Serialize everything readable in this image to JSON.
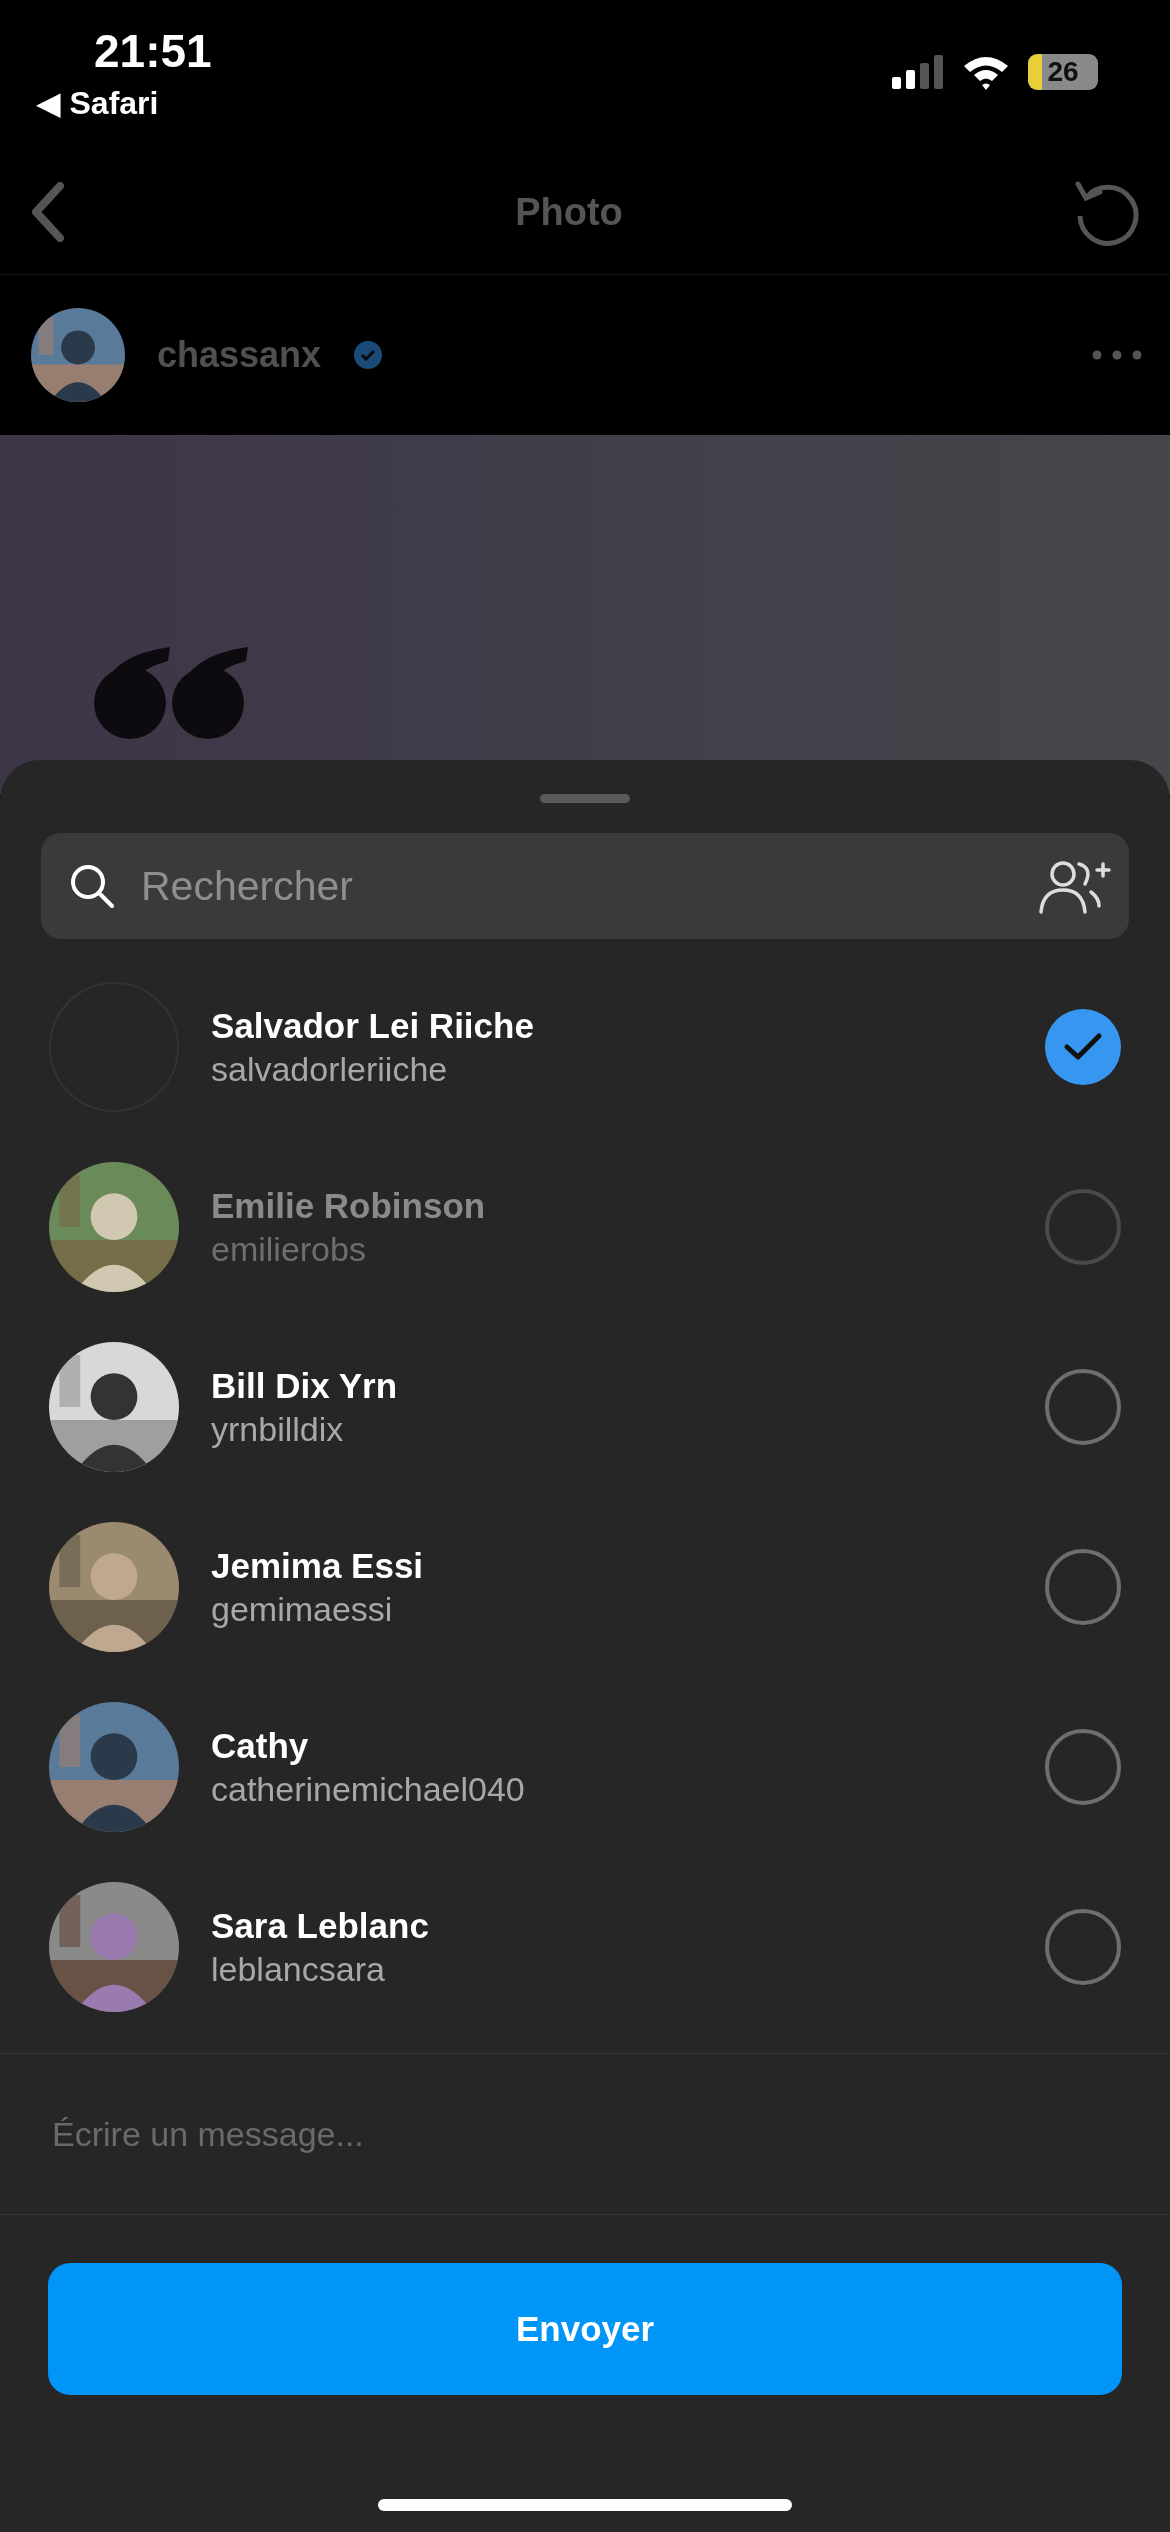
{
  "status_bar": {
    "time": "21:51",
    "back_app": "◀ Safari",
    "battery": "26"
  },
  "nav": {
    "title": "Photo"
  },
  "post": {
    "username": "chassanx",
    "verified": true
  },
  "share_sheet": {
    "search": {
      "placeholder": "Rechercher"
    },
    "contacts": [
      {
        "name": "Salvador Lei Riiche",
        "username": "salvadorleriiche",
        "selected": true,
        "disabled": false,
        "avatar": {
          "kind": "empty"
        }
      },
      {
        "name": "Emilie Robinson",
        "username": "emilierobs",
        "selected": false,
        "disabled": true
      },
      {
        "name": "Bill Dix Yrn",
        "username": "yrnbilldix",
        "selected": false,
        "disabled": false
      },
      {
        "name": "Jemima Essi",
        "username": "gemimaessi",
        "selected": false,
        "disabled": false
      },
      {
        "name": "Cathy",
        "username": "catherinemichael040",
        "selected": false,
        "disabled": false
      },
      {
        "name": "Sara Leblanc",
        "username": "leblancsara",
        "selected": false,
        "disabled": false
      }
    ],
    "message": {
      "placeholder": "Écrire un message..."
    },
    "send_button": "Envoyer"
  }
}
